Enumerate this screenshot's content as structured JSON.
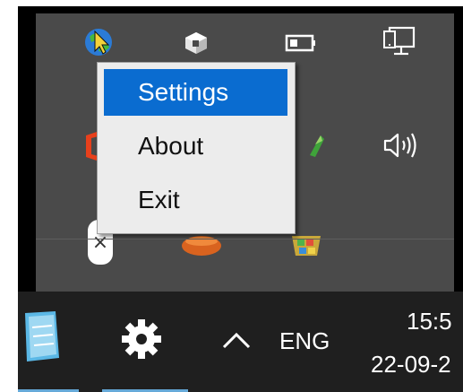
{
  "tray_overflow": {
    "icons": [
      {
        "name": "globe-cursor-app-icon"
      },
      {
        "name": "cube-app-icon"
      },
      {
        "name": "battery-icon"
      },
      {
        "name": "network-icon"
      },
      {
        "name": "office-icon"
      },
      {
        "name": "green-app-icon"
      },
      {
        "name": "volume-icon"
      },
      {
        "name": "close-badge-icon",
        "glyph": "×"
      },
      {
        "name": "orange-app-icon"
      },
      {
        "name": "cube-colorful-app-icon"
      }
    ]
  },
  "context_menu": {
    "items": [
      {
        "label": "Settings",
        "selected": true
      },
      {
        "label": "About",
        "selected": false
      },
      {
        "label": "Exit",
        "selected": false
      }
    ]
  },
  "taskbar": {
    "chevron": "^",
    "language": "ENG",
    "time": "15:5",
    "date": "22-09-2"
  },
  "colors": {
    "tray_background": "#4a4a4a",
    "taskbar_background": "#1f1f1f",
    "menu_background": "#ececec",
    "menu_selection": "#0a6cd0",
    "active_underline": "#65a9d8"
  }
}
